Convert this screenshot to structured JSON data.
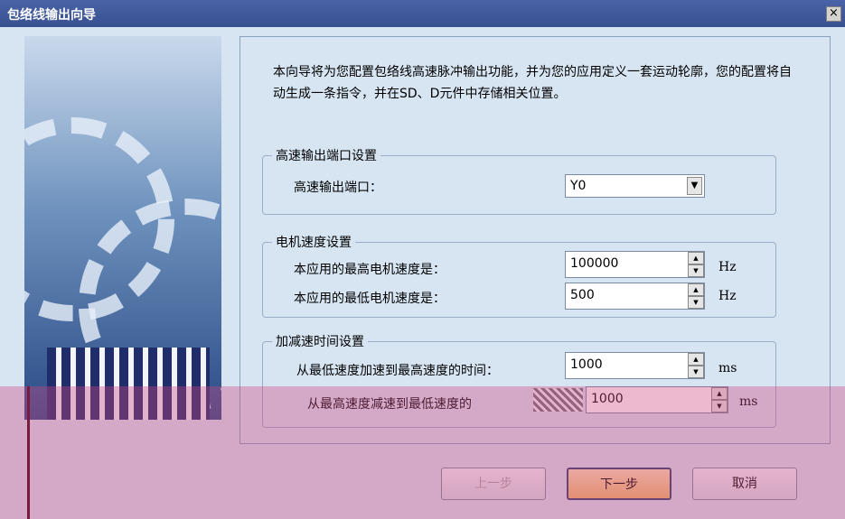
{
  "window": {
    "title": "包络线输出向导",
    "close_glyph": "×"
  },
  "intro": "本向导将为您配置包络线高速脉冲输出功能，并为您的应用定义一套运动轮廓，您的配置将自动生成一条指令，并在SD、D元件中存储相关位置。",
  "port_group": {
    "title": "高速输出端口设置",
    "label": "高速输出端口：",
    "value": "Y0"
  },
  "motor_group": {
    "title": "电机速度设置",
    "max_label": "本应用的最高电机速度是：",
    "max_value": "100000",
    "min_label": "本应用的最低电机速度是：",
    "min_value": "500",
    "unit": "Hz"
  },
  "accel_group": {
    "title": "加减速时间设置",
    "accel_label": "从最低速度加速到最高速度的时间：",
    "accel_value": "1000",
    "decel_label": "从最高速度减速到最低速度的",
    "decel_value": "1000",
    "unit": "ms"
  },
  "buttons": {
    "back": "上一步",
    "next": "下一步",
    "cancel": "取消"
  }
}
